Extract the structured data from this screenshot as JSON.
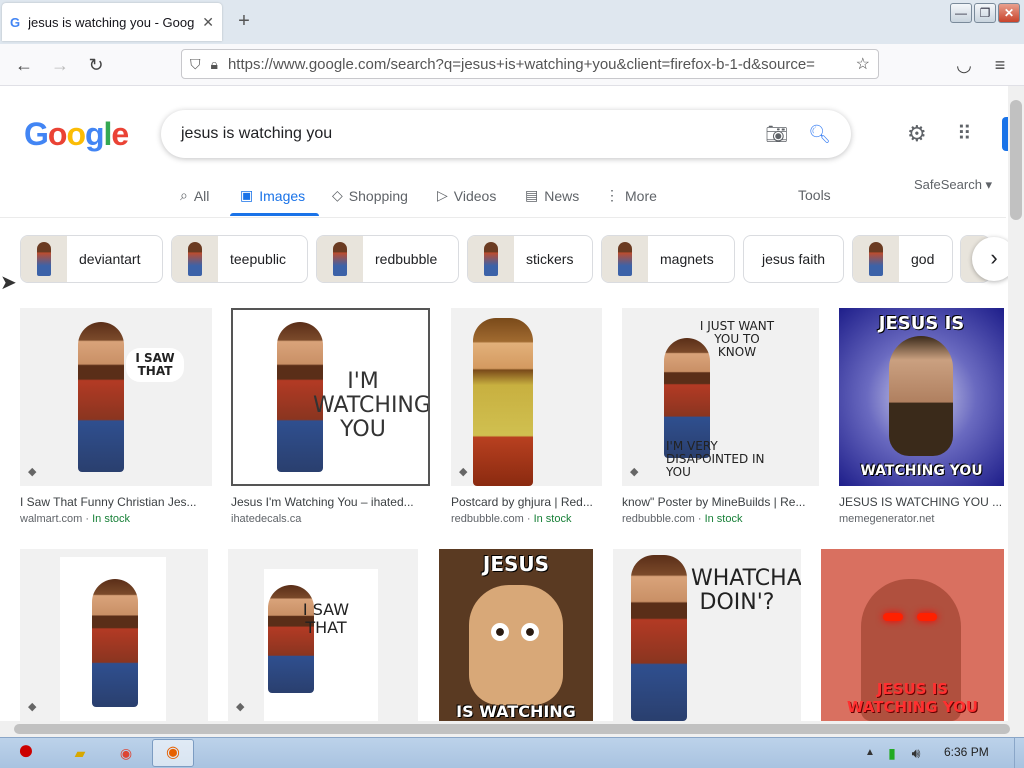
{
  "browser": {
    "tab_title": "jesus is watching you - Goog",
    "tab_favicon": "G",
    "new_tab": "+",
    "url": "https://www.google.com/search?q=jesus+is+watching+you&client=firefox-b-1-d&source=",
    "window_buttons": {
      "minimize": "—",
      "maximize": "❐",
      "close": "✕"
    }
  },
  "google": {
    "logo": [
      "G",
      "o",
      "o",
      "g",
      "l",
      "e"
    ],
    "query": "jesus is watching you",
    "tabs": [
      {
        "label": "All",
        "icon": "search-icon"
      },
      {
        "label": "Images",
        "icon": "image-icon"
      },
      {
        "label": "Shopping",
        "icon": "tag-icon"
      },
      {
        "label": "Videos",
        "icon": "play-icon"
      },
      {
        "label": "News",
        "icon": "newspaper-icon"
      },
      {
        "label": "More",
        "icon": "more-vert-icon"
      }
    ],
    "tools": "Tools",
    "safesearch": "SafeSearch ▾",
    "chips": [
      "deviantart",
      "teepublic",
      "redbubble",
      "stickers",
      "magnets",
      "jesus faith",
      "god"
    ],
    "results_row1": [
      {
        "title": "I Saw That Funny Christian Jes...",
        "source": "walmart.com",
        "stock": "In stock",
        "caption": "I SAW THAT",
        "tag": "◆"
      },
      {
        "title": "Jesus I'm Watching You – ihated...",
        "source": "ihatedecals.ca",
        "stock": "",
        "caption": "I'M WATCHING YOU",
        "tag": ""
      },
      {
        "title": "Postcard by ghjura | Red...",
        "source": "redbubble.com",
        "stock": "In stock",
        "caption": "",
        "tag": "◆"
      },
      {
        "title": "know\" Poster by MineBuilds | Re...",
        "source": "redbubble.com",
        "stock": "In stock",
        "caption": "I JUST WANT YOU TO KNOW",
        "caption2": "I'M VERY DISAPOINTED IN YOU",
        "tag": "◆"
      },
      {
        "title": "JESUS IS WATCHING YOU ...",
        "source": "memegenerator.net",
        "stock": "",
        "caption": "JESUS IS",
        "caption2": "WATCHING YOU",
        "tag": ""
      }
    ],
    "results_row2": [
      {
        "caption": "",
        "tag": "◆"
      },
      {
        "caption": "I SAW THAT",
        "tag": "◆"
      },
      {
        "caption": "JESUS",
        "caption2": "IS WATCHING YOU"
      },
      {
        "caption": "WHATCHA DOIN'?"
      },
      {
        "caption": "JESUS IS",
        "caption2": "WATCHING YOU"
      }
    ]
  },
  "taskbar": {
    "clock": "6:36 PM"
  }
}
